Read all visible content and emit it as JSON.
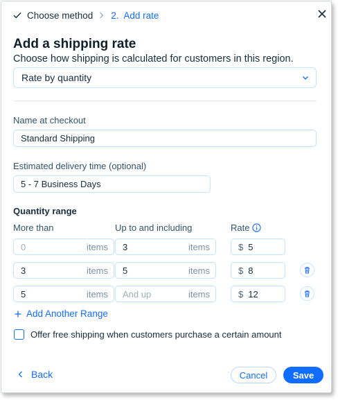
{
  "breadcrumb": {
    "step1": "Choose method",
    "step2": "2.  Add rate"
  },
  "title": "Add a shipping rate",
  "subtitle": "Choose how shipping is calculated for customers in this region.",
  "method_select": {
    "value": "Rate by quantity"
  },
  "name_field": {
    "label": "Name at checkout",
    "value": "Standard Shipping"
  },
  "delivery_field": {
    "label": "Estimated delivery time (optional)",
    "value": "5 - 7 Business Days"
  },
  "quantity": {
    "heading": "Quantity range",
    "col_more": "More than",
    "col_upto": "Up to and including",
    "col_rate": "Rate",
    "unit": "items",
    "currency": "$",
    "rows": [
      {
        "more": "0",
        "upto": "3",
        "rate": "5",
        "more_is_placeholder": true,
        "upto_is_placeholder": false
      },
      {
        "more": "3",
        "upto": "5",
        "rate": "8",
        "more_is_placeholder": false,
        "upto_is_placeholder": false
      },
      {
        "more": "5",
        "upto": "And up",
        "rate": "12",
        "more_is_placeholder": false,
        "upto_is_placeholder": true
      }
    ]
  },
  "add_range": "Add Another Range",
  "free_shipping": {
    "label": "Offer free shipping when customers purchase a certain amount",
    "checked": false
  },
  "footer": {
    "back": "Back",
    "cancel": "Cancel",
    "save": "Save"
  },
  "colors": {
    "accent": "#116dff",
    "text": "#162d3d",
    "border": "#c1e4fe"
  },
  "icons": [
    "check-icon",
    "chevron-right-icon",
    "close-icon",
    "chevron-down-icon",
    "info-icon",
    "trash-icon",
    "plus-icon",
    "chevron-left-icon"
  ]
}
